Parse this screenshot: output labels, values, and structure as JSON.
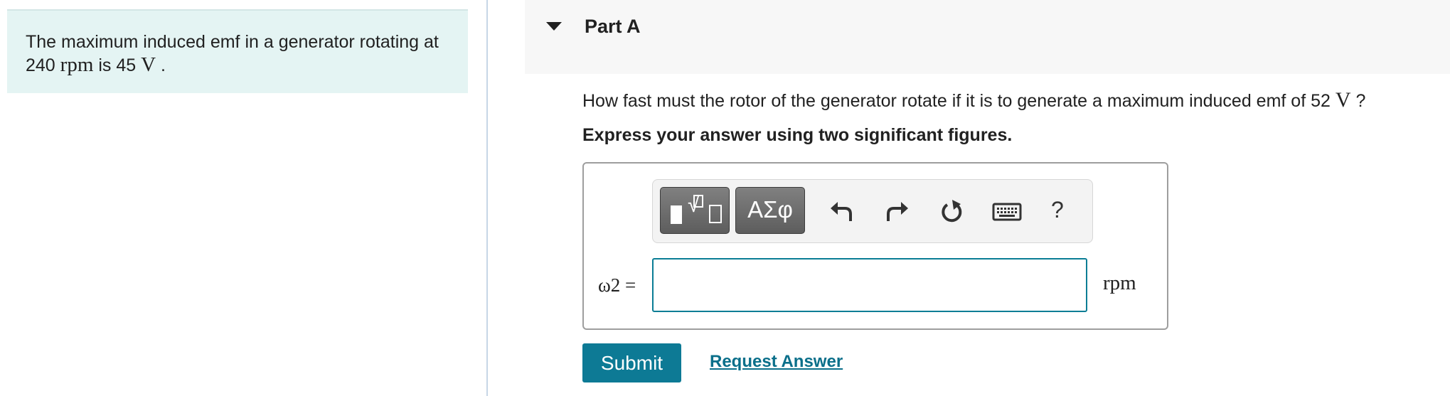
{
  "intro": {
    "text_before": "The maximum induced emf in a generator rotating at 240 ",
    "rpm_unit": "rpm",
    "text_mid": " is 45 ",
    "volt_unit": "V",
    "text_after": " ."
  },
  "part": {
    "title": "Part A"
  },
  "question": {
    "text": "How fast must the rotor of the generator rotate if it is to generate a maximum induced emf of 52 ",
    "unit": "V",
    "end": " ?"
  },
  "instruction": "Express your answer using two significant figures.",
  "toolbar": {
    "greek_label": "ΑΣφ",
    "help_label": "?",
    "icons": [
      "templates-icon",
      "greek-symbols-icon",
      "undo-icon",
      "redo-icon",
      "reset-icon",
      "keyboard-icon",
      "help-icon"
    ]
  },
  "answer": {
    "label": "ω2 =",
    "value": "",
    "unit": "rpm"
  },
  "actions": {
    "submit": "Submit",
    "request": "Request Answer"
  },
  "colors": {
    "accent": "#0d7a95",
    "link": "#0a6f8a",
    "intro_bg": "#e4f4f3",
    "header_bg": "#f7f7f7"
  }
}
